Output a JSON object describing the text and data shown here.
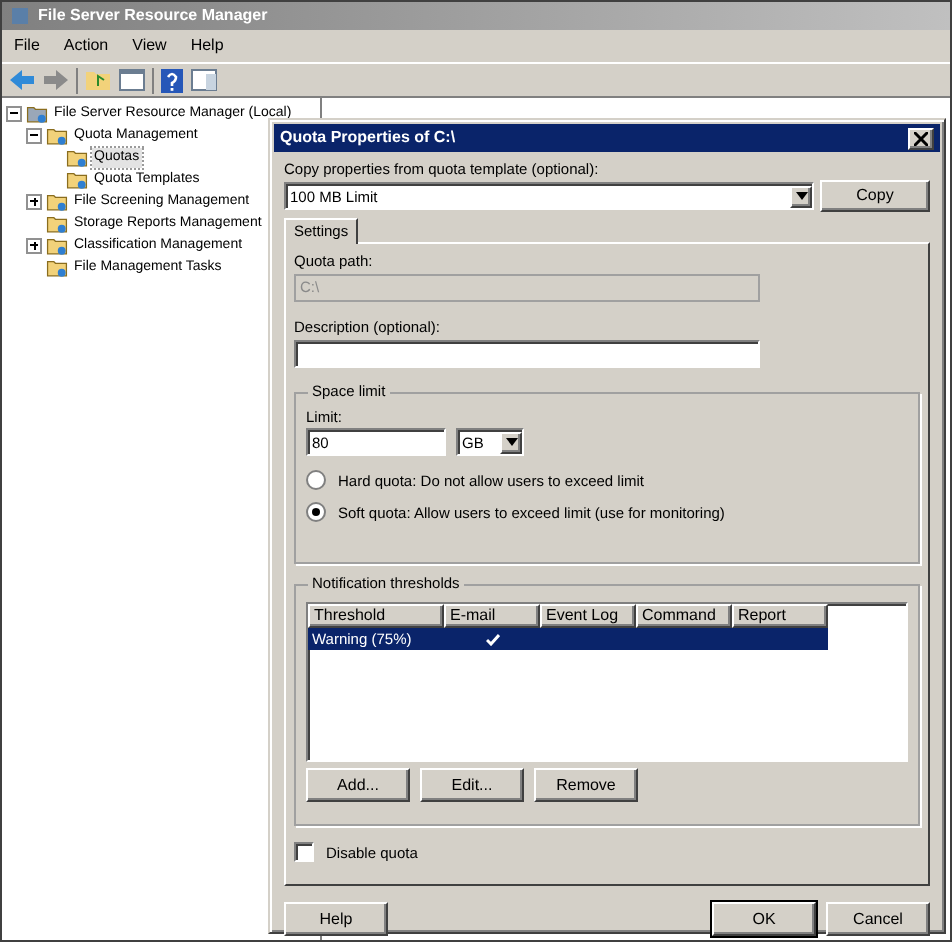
{
  "window": {
    "title": "File Server Resource Manager"
  },
  "menu": [
    "File",
    "Action",
    "View",
    "Help"
  ],
  "tree": [
    {
      "label": "File Server Resource Manager (Local)",
      "expanded": true,
      "selected": false,
      "children": [
        {
          "label": "Quota Management",
          "expanded": true,
          "selected": false,
          "children": [
            {
              "label": "Quotas",
              "selected": true
            },
            {
              "label": "Quota Templates",
              "selected": false
            }
          ]
        },
        {
          "label": "File Screening Management",
          "expanded": false,
          "selected": false
        },
        {
          "label": "Storage Reports Management",
          "selected": false
        },
        {
          "label": "Classification Management",
          "expanded": false,
          "selected": false
        },
        {
          "label": "File Management Tasks",
          "selected": false
        }
      ]
    }
  ],
  "dialog": {
    "title": "Quota Properties of C:\\",
    "template_label": "Copy properties from quota template (optional):",
    "template_value": "100 MB Limit",
    "copy_button": "Copy",
    "tabs": [
      {
        "label": "Settings",
        "selected": true
      }
    ],
    "quota_path_label": "Quota path:",
    "quota_path_value": "C:\\",
    "description_label": "Description (optional):",
    "space_limit": {
      "title": "Space limit",
      "limit_label": "Limit:",
      "limit_value": "80",
      "unit": "GB",
      "options": [
        {
          "label": "Hard quota: Do not allow users to exceed limit",
          "selected": false
        },
        {
          "label": "Soft quota: Allow users to exceed limit (use for monitoring)",
          "selected": true
        }
      ]
    },
    "notifications": {
      "title": "Notification thresholds",
      "columns": [
        "Threshold",
        "E-mail",
        "Event Log",
        "Command",
        "Report"
      ],
      "rows": [
        {
          "threshold": "Warning (75%)",
          "email": true,
          "selected": true
        }
      ],
      "buttons": [
        "Add...",
        "Edit...",
        "Remove"
      ]
    },
    "disable_quota": {
      "label": "Disable quota",
      "checked": false
    },
    "help_button": "Help",
    "ok_button": "OK",
    "cancel_button": "Cancel"
  }
}
